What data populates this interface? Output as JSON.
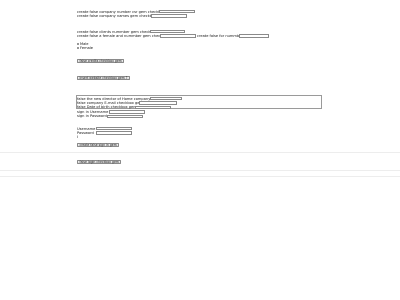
{
  "section1": {
    "line1": "create false company number csr gem checkbox",
    "line2": "create false company names gem checkbox"
  },
  "section2": {
    "line1": "create false clients nummber gem checkbox",
    "line2": "create false a female and nummber gem checkbox",
    "line2_suffix": "create false for nummber"
  },
  "gender": {
    "options": [
      "Male",
      "Female"
    ]
  },
  "buttons": {
    "save_credits": "false credits checkbox gem",
    "insert_website": "insert website checkbox gem ?",
    "create_sign_in": "create false sign in gem",
    "false_login": "false login checkbox gem"
  },
  "director_form": {
    "line1": "false the new director of Home company",
    "line2": "false company E-mail checkbox gem",
    "line3": "false Date of birth checkbox gem",
    "line4": "sign in Username",
    "line5": "sign in Password"
  },
  "login": {
    "username_label": "Username",
    "password_label": "Password",
    "extra_label": "I"
  }
}
